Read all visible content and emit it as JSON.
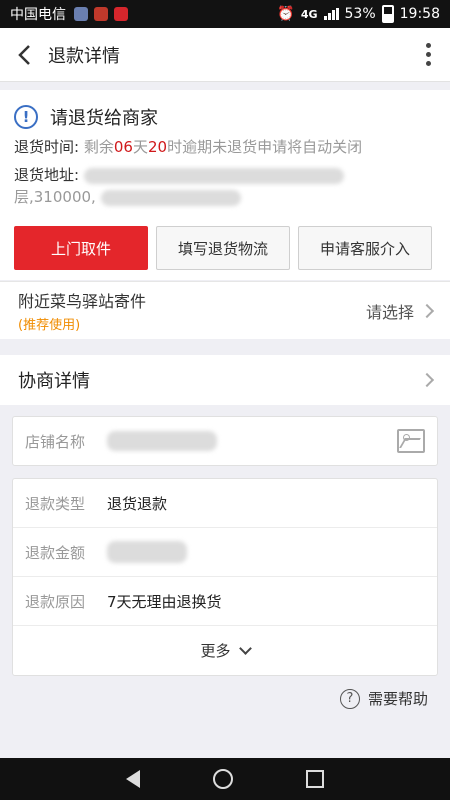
{
  "status_bar": {
    "carrier": "中国电信",
    "network": "4G",
    "battery": "53%",
    "time": "19:58"
  },
  "header": {
    "title": "退款详情",
    "back_icon": "back-arrow-icon",
    "more_icon": "more-vertical-icon"
  },
  "notice": {
    "title": "请退货给商家",
    "icon": "exclamation-circle-icon",
    "time_label": "退货时间:",
    "time_prefix": "剩余",
    "days": "06",
    "days_unit": "天",
    "hours": "20",
    "time_suffix": "时逾期未退货申请将自动关闭",
    "address_label": "退货地址:",
    "address_visible_tail": "层,310000,",
    "buttons": {
      "pickup": "上门取件",
      "logistics": "填写退货物流",
      "service": "申请客服介入"
    }
  },
  "cainiao": {
    "title": "附近菜鸟驿站寄件",
    "badge": "(推荐使用)",
    "action": "请选择"
  },
  "negotiation": {
    "title": "协商详情"
  },
  "shop": {
    "label": "店铺名称"
  },
  "refund": {
    "type_label": "退款类型",
    "type_value": "退货退款",
    "amount_label": "退款金额",
    "reason_label": "退款原因",
    "reason_value": "7天无理由退换货",
    "more": "更多"
  },
  "help": {
    "label": "需要帮助"
  },
  "colors": {
    "primary_red": "#e4262b",
    "countdown_red": "#d0191b",
    "recommend_orange": "#f08c00",
    "info_blue": "#3a6fc4"
  }
}
